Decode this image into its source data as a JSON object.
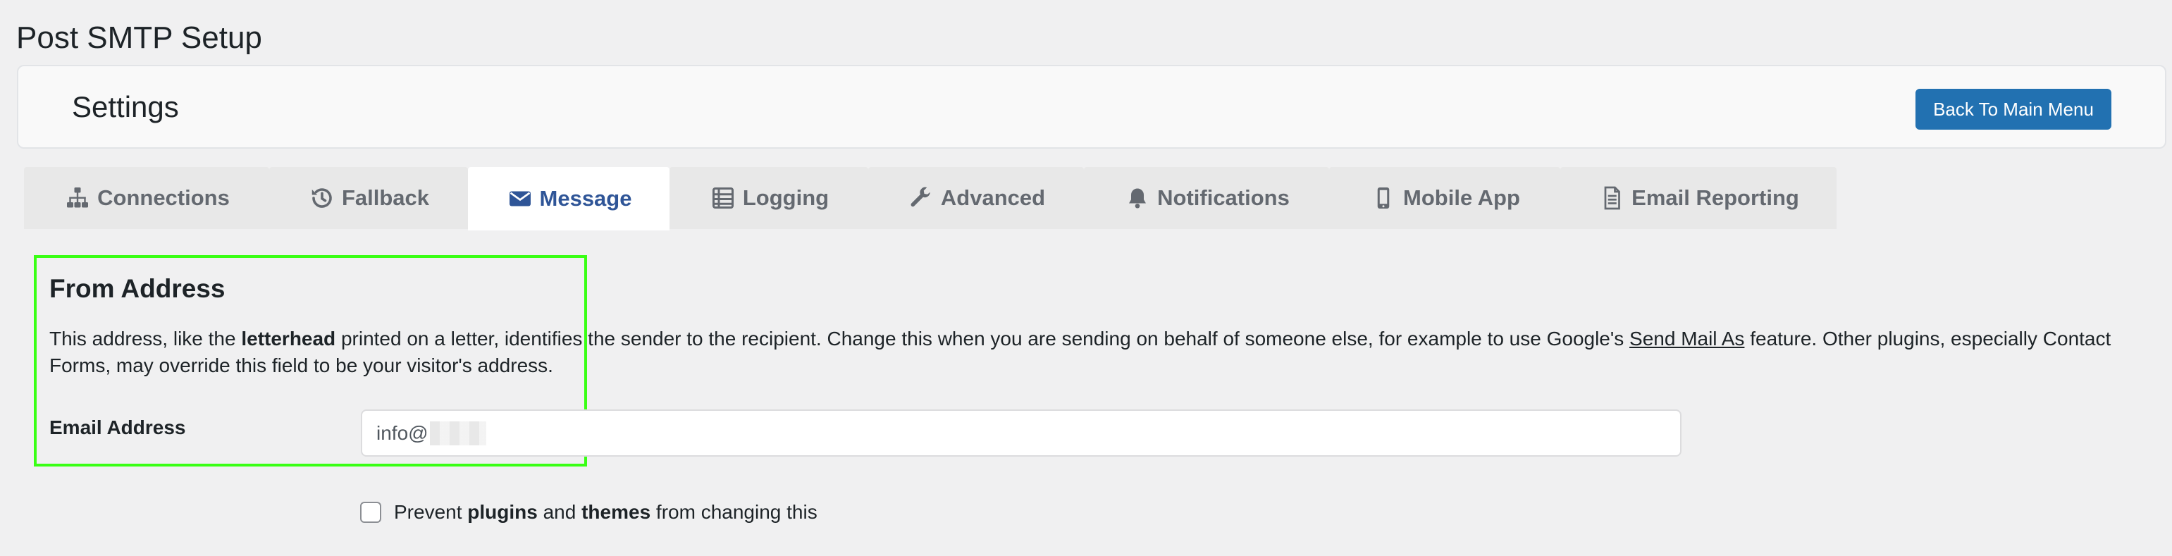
{
  "page_title": "Post SMTP Setup",
  "settings_bar": {
    "title": "Settings",
    "back_button_label": "Back To Main Menu"
  },
  "tabs": [
    {
      "label": "Connections",
      "icon": "sitemap-icon",
      "active": false
    },
    {
      "label": "Fallback",
      "icon": "history-icon",
      "active": false
    },
    {
      "label": "Message",
      "icon": "envelope-icon",
      "active": true
    },
    {
      "label": "Logging",
      "icon": "list-icon",
      "active": false
    },
    {
      "label": "Advanced",
      "icon": "wrench-icon",
      "active": false
    },
    {
      "label": "Notifications",
      "icon": "bell-icon",
      "active": false
    },
    {
      "label": "Mobile App",
      "icon": "mobile-icon",
      "active": false
    },
    {
      "label": "Email Reporting",
      "icon": "document-icon",
      "active": false
    }
  ],
  "from_address": {
    "heading": "From Address",
    "description": {
      "part1": "This address, like the ",
      "bold1": "letterhead",
      "part2": " printed on a letter, identifies the sender to the recipient. Change this when you are sending on behalf of someone else, for example to use Google's ",
      "link": "Send Mail As",
      "part3": " feature. Other plugins, especially Contact Forms, may override this field to be your visitor's address."
    },
    "email_label": "Email Address",
    "email_value": "info@"
  },
  "prevent_checkbox": {
    "checked": false,
    "part1": "Prevent ",
    "bold1": "plugins",
    "part2": " and ",
    "bold2": "themes",
    "part3": " from changing this"
  },
  "colors": {
    "accent": "#2271b1",
    "active_tab_text": "#2f5597",
    "highlight": "#39ff14"
  }
}
